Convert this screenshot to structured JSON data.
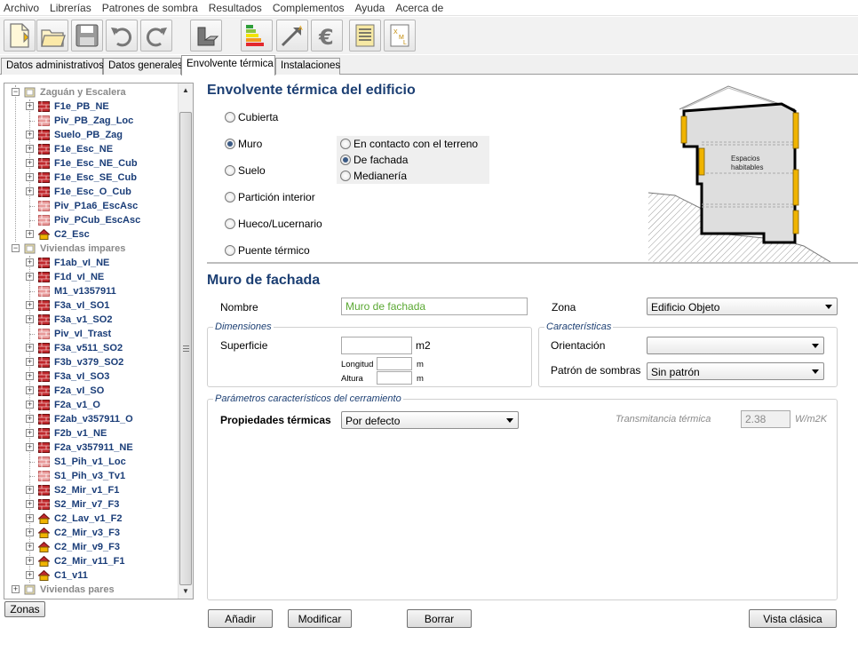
{
  "menu": [
    "Archivo",
    "Librerías",
    "Patrones de sombra",
    "Resultados",
    "Complementos",
    "Ayuda",
    "Acerca de"
  ],
  "toolbar": {
    "icons": [
      "new-file-icon",
      "open-folder-icon",
      "save-disk-icon",
      "undo-icon",
      "redo-icon",
      "3d-view-icon",
      "energy-rating-icon",
      "calculate-arrow-icon",
      "euro-icon",
      "report-document-icon",
      "xml-export-icon"
    ]
  },
  "tabs": [
    {
      "label": "Datos administrativos",
      "active": false
    },
    {
      "label": "Datos generales",
      "active": false
    },
    {
      "label": "Envolvente térmica",
      "active": true
    },
    {
      "label": "Instalaciones",
      "active": false
    }
  ],
  "tree": [
    {
      "label": "Zaguán y Escalera",
      "level": 0,
      "type": "group",
      "expander": "-"
    },
    {
      "label": "F1e_PB_NE",
      "level": 1,
      "type": "wall",
      "expander": "+"
    },
    {
      "label": "Piv_PB_Zag_Loc",
      "level": 1,
      "type": "partition",
      "expander": ""
    },
    {
      "label": "Suelo_PB_Zag",
      "level": 1,
      "type": "wall",
      "expander": "+"
    },
    {
      "label": "F1e_Esc_NE",
      "level": 1,
      "type": "wall",
      "expander": "+"
    },
    {
      "label": "F1e_Esc_NE_Cub",
      "level": 1,
      "type": "wall",
      "expander": "+"
    },
    {
      "label": "F1e_Esc_SE_Cub",
      "level": 1,
      "type": "wall",
      "expander": "+"
    },
    {
      "label": "F1e_Esc_O_Cub",
      "level": 1,
      "type": "wall",
      "expander": "+"
    },
    {
      "label": "Piv_P1a6_EscAsc",
      "level": 1,
      "type": "partition",
      "expander": ""
    },
    {
      "label": "Piv_PCub_EscAsc",
      "level": 1,
      "type": "partition",
      "expander": ""
    },
    {
      "label": "C2_Esc",
      "level": 1,
      "type": "roof",
      "expander": "+"
    },
    {
      "label": "Viviendas impares",
      "level": 0,
      "type": "group",
      "expander": "-"
    },
    {
      "label": "F1ab_vI_NE",
      "level": 1,
      "type": "wall",
      "expander": "+"
    },
    {
      "label": "F1d_vI_NE",
      "level": 1,
      "type": "wall",
      "expander": "+"
    },
    {
      "label": "M1_v1357911",
      "level": 1,
      "type": "partition",
      "expander": ""
    },
    {
      "label": "F3a_vI_SO1",
      "level": 1,
      "type": "wall",
      "expander": "+"
    },
    {
      "label": "F3a_v1_SO2",
      "level": 1,
      "type": "wall",
      "expander": "+"
    },
    {
      "label": "Piv_vI_Trast",
      "level": 1,
      "type": "partition",
      "expander": ""
    },
    {
      "label": "F3a_v511_SO2",
      "level": 1,
      "type": "wall",
      "expander": "+"
    },
    {
      "label": "F3b_v379_SO2",
      "level": 1,
      "type": "wall",
      "expander": "+"
    },
    {
      "label": "F3a_vI_SO3",
      "level": 1,
      "type": "wall",
      "expander": "+"
    },
    {
      "label": "F2a_vI_SO",
      "level": 1,
      "type": "wall",
      "expander": "+"
    },
    {
      "label": "F2a_v1_O",
      "level": 1,
      "type": "wall",
      "expander": "+"
    },
    {
      "label": "F2ab_v357911_O",
      "level": 1,
      "type": "wall",
      "expander": "+"
    },
    {
      "label": "F2b_v1_NE",
      "level": 1,
      "type": "wall",
      "expander": "+"
    },
    {
      "label": "F2a_v357911_NE",
      "level": 1,
      "type": "wall",
      "expander": "+"
    },
    {
      "label": "S1_Pih_v1_Loc",
      "level": 1,
      "type": "partition",
      "expander": ""
    },
    {
      "label": "S1_Pih_v3_Tv1",
      "level": 1,
      "type": "partition",
      "expander": ""
    },
    {
      "label": "S2_Mir_v1_F1",
      "level": 1,
      "type": "wall",
      "expander": "+"
    },
    {
      "label": "S2_Mir_v7_F3",
      "level": 1,
      "type": "wall",
      "expander": "+"
    },
    {
      "label": "C2_Lav_v1_F2",
      "level": 1,
      "type": "roof",
      "expander": "+"
    },
    {
      "label": "C2_Mir_v3_F3",
      "level": 1,
      "type": "roof",
      "expander": "+"
    },
    {
      "label": "C2_Mir_v9_F3",
      "level": 1,
      "type": "roof",
      "expander": "+"
    },
    {
      "label": "C2_Mir_v11_F1",
      "level": 1,
      "type": "roof",
      "expander": "+"
    },
    {
      "label": "C1_v11",
      "level": 1,
      "type": "roof",
      "expander": "+"
    },
    {
      "label": "Viviendas pares",
      "level": 0,
      "type": "group",
      "expander": "+"
    }
  ],
  "zonas_button": "Zonas",
  "envelope": {
    "title": "Envolvente térmica del edificio",
    "options": [
      "Cubierta",
      "Muro",
      "Suelo",
      "Partición interior",
      "Hueco/Lucernario",
      "Puente térmico"
    ],
    "selected": "Muro",
    "subtypes": [
      "En contacto con el terreno",
      "De fachada",
      "Medianería"
    ],
    "selected_subtype": "De fachada",
    "diagram_label_1": "Espacios",
    "diagram_label_2": "habitables"
  },
  "form": {
    "title": "Muro de fachada",
    "nombre_label": "Nombre",
    "nombre_value": "Muro de fachada",
    "zona_label": "Zona",
    "zona_value": "Edificio Objeto",
    "dimensiones_legend": "Dimensiones",
    "superficie_label": "Superficie",
    "superficie_value": "",
    "superficie_unit": "m2",
    "longitud_label": "Longitud",
    "longitud_unit": "m",
    "altura_label": "Altura",
    "altura_unit": "m",
    "caracteristicas_legend": "Características",
    "orientacion_label": "Orientación",
    "orientacion_value": "",
    "patron_label": "Patrón de sombras",
    "patron_value": "Sin patrón",
    "parametros_legend": "Parámetros característicos del cerramiento",
    "propiedades_label": "Propiedades térmicas",
    "propiedades_value": "Por defecto",
    "transmitancia_label": "Transmitancia térmica",
    "transmitancia_value": "2.38",
    "transmitancia_unit": "W/m2K"
  },
  "buttons": {
    "anadir": "Añadir",
    "modificar": "Modificar",
    "borrar": "Borrar",
    "vista_clasica": "Vista clásica"
  },
  "colors": {
    "title_blue": "#1c3f73",
    "tree_text": "#1a3d78",
    "nombre_green": "#5aa832",
    "wall_red": "#c0282d",
    "insulation_yellow": "#f0b400"
  }
}
